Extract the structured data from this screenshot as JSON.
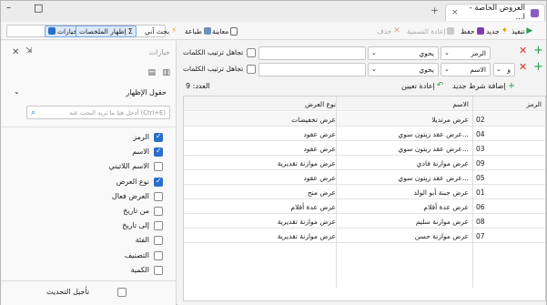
{
  "window": {
    "tab_title": "العروض الخاصة - ا...",
    "tab_close": "×",
    "new_tab": "+",
    "win_min": "–",
    "win_max": "□"
  },
  "toolbar": {
    "execute": "تنفيذ",
    "new": "جديد",
    "save": "حفظ",
    "rename": "إعادة التسمية",
    "delete": "حذف",
    "print": "طباعة",
    "preview": "معاينة",
    "search_ai": "بحث آني",
    "show_summaries": "إظهار الملخصات",
    "options": "خيارات",
    "search_value": ""
  },
  "side": {
    "title": "خيارات",
    "fields_title": "حقول الإظهار",
    "search_placeholder": "أدخل هنا ما تريد البحث عنه (Ctrl+E)",
    "fields": [
      {
        "label": "الرمز",
        "checked": true
      },
      {
        "label": "الاسم",
        "checked": true
      },
      {
        "label": "الاسم اللاتيني",
        "checked": false
      },
      {
        "label": "نوع العرض",
        "checked": true
      },
      {
        "label": "العرض فعال",
        "checked": false
      },
      {
        "label": "من تاريخ",
        "checked": false
      },
      {
        "label": "إلى تاريخ",
        "checked": false
      },
      {
        "label": "الفئة",
        "checked": false
      },
      {
        "label": "التصنيف",
        "checked": false
      },
      {
        "label": "الكمية",
        "checked": false
      }
    ],
    "defer_update": "تأجيل التحديث"
  },
  "filters": {
    "rows": [
      {
        "field": "الرمز",
        "op": "يحوي",
        "value": "",
        "ignore_order": "تجاهل ترتيب الكلمات",
        "logic": ""
      },
      {
        "field": "الاسم",
        "op": "يحوي",
        "value": "",
        "ignore_order": "تجاهل ترتيب الكلمات",
        "logic": "و"
      }
    ],
    "add_condition": "إضافة شرط جديد",
    "reset": "إعادة تعيين",
    "count_label": "العدد: 9"
  },
  "grid": {
    "columns": [
      "الرمز",
      "الاسم",
      "نوع العرض"
    ],
    "filter_row": [
      "",
      "عرض مرتديلا",
      "عرض تخفيضات"
    ],
    "rows": [
      [
        "02",
        "عرض مرتديلا",
        "عرض تخفيضات"
      ],
      [
        "04",
        "عرض عقد زيتون سوي...",
        "عرض عقود"
      ],
      [
        "03",
        "عرض عقد زيتون سوي...",
        "عرض عقود"
      ],
      [
        "09",
        "عرض موازنة فادي",
        "عرض موازنة تقديرية"
      ],
      [
        "05",
        "عرض عقد زيتون سوي...",
        "عرض عقود"
      ],
      [
        "01",
        "عرض جبنة أبو الولد",
        "عرض منح"
      ],
      [
        "06",
        "عرض عدة أقلام",
        "عرض عدة أقلام"
      ],
      [
        "08",
        "عرض موازنة سليم",
        "عرض موازنة تقديرية"
      ],
      [
        "07",
        "عرض موازنة حسن",
        "عرض موازنة تقديرية"
      ]
    ]
  },
  "colors": {
    "accent": "#2a6fc9",
    "red": "#d93025",
    "green": "#2e9b4a",
    "highlight": "#cfe2fb"
  }
}
